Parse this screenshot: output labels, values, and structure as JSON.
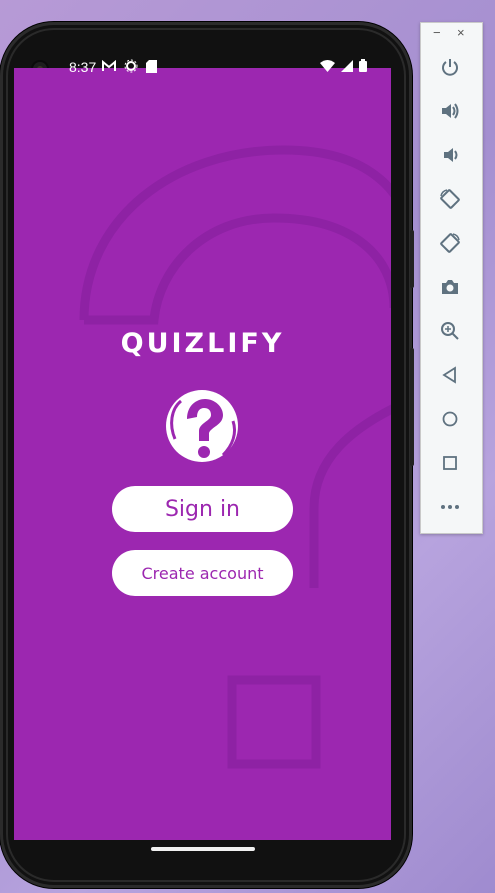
{
  "status_bar": {
    "time": "8:37"
  },
  "app": {
    "logo_text": "QUIZLIFY",
    "sign_in_label": "Sign in",
    "create_account_label": "Create account",
    "theme_color": "#9c27b0"
  },
  "emulator_panel": {
    "minimize_label": "−",
    "close_label": "×",
    "buttons": [
      "power-icon",
      "volume-up-icon",
      "volume-down-icon",
      "rotate-left-icon",
      "rotate-right-icon",
      "camera-icon",
      "zoom-icon",
      "back-icon",
      "home-icon",
      "overview-icon",
      "more-icon"
    ]
  }
}
